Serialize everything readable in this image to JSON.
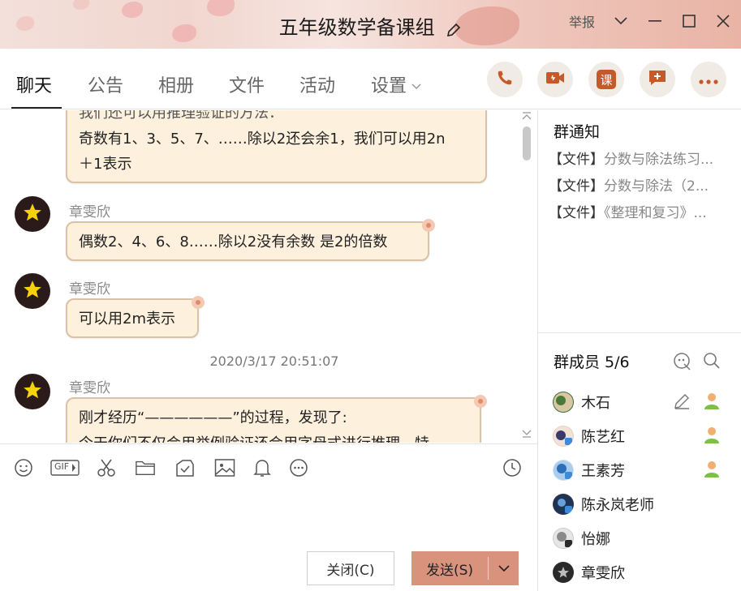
{
  "window": {
    "title": "五年级数学备课组",
    "report_label": "举报"
  },
  "tabs": [
    {
      "label": "聊天"
    },
    {
      "label": "公告"
    },
    {
      "label": "相册"
    },
    {
      "label": "文件"
    },
    {
      "label": "活动"
    },
    {
      "label": "设置"
    }
  ],
  "header_actions": [
    {
      "icon": "phone-icon"
    },
    {
      "icon": "video-icon"
    },
    {
      "icon": "class-icon",
      "label": "课"
    },
    {
      "icon": "add-comment-icon"
    },
    {
      "icon": "more-icon"
    }
  ],
  "messages": [
    {
      "text_top": "我们还可以用推理验证的方法：",
      "text": "奇数有1、3、5、7、……除以2还会余1，我们可以用2n",
      "text2": "＋1表示"
    },
    {
      "sender": "章雯欣",
      "text": "偶数2、4、6、8……除以2没有余数  是2的倍数"
    },
    {
      "sender": "章雯欣",
      "text": "可以用2m表示"
    },
    {
      "timestamp": "2020/3/17 20:51:07"
    },
    {
      "sender": "章雯欣",
      "text": "刚才经历“——————”的过程，发现了:",
      "text2": "今天你们不仅会用举例验证还会用字母式进行推理，特"
    }
  ],
  "toolbar": {
    "gif_label": "GIF"
  },
  "buttons": {
    "close": "关闭(C)",
    "send": "发送(S)"
  },
  "notice": {
    "title": "群通知",
    "items": [
      {
        "tag": "【文件】",
        "text": "分数与除法练习..."
      },
      {
        "tag": "【文件】",
        "text": "分数与除法（2..."
      },
      {
        "tag": "【文件】",
        "text": "《整理和复习》..."
      }
    ]
  },
  "members": {
    "title": "群成员 5/6",
    "list": [
      {
        "name": "木石"
      },
      {
        "name": "陈艺红"
      },
      {
        "name": "王素芳"
      },
      {
        "name": "陈永岚老师"
      },
      {
        "name": "怡娜"
      },
      {
        "name": "章雯欣"
      }
    ]
  },
  "colors": {
    "accent_send": "#d9937d",
    "bubble_bg": "#fdf0dd",
    "bubble_border": "#d9c2a6"
  }
}
